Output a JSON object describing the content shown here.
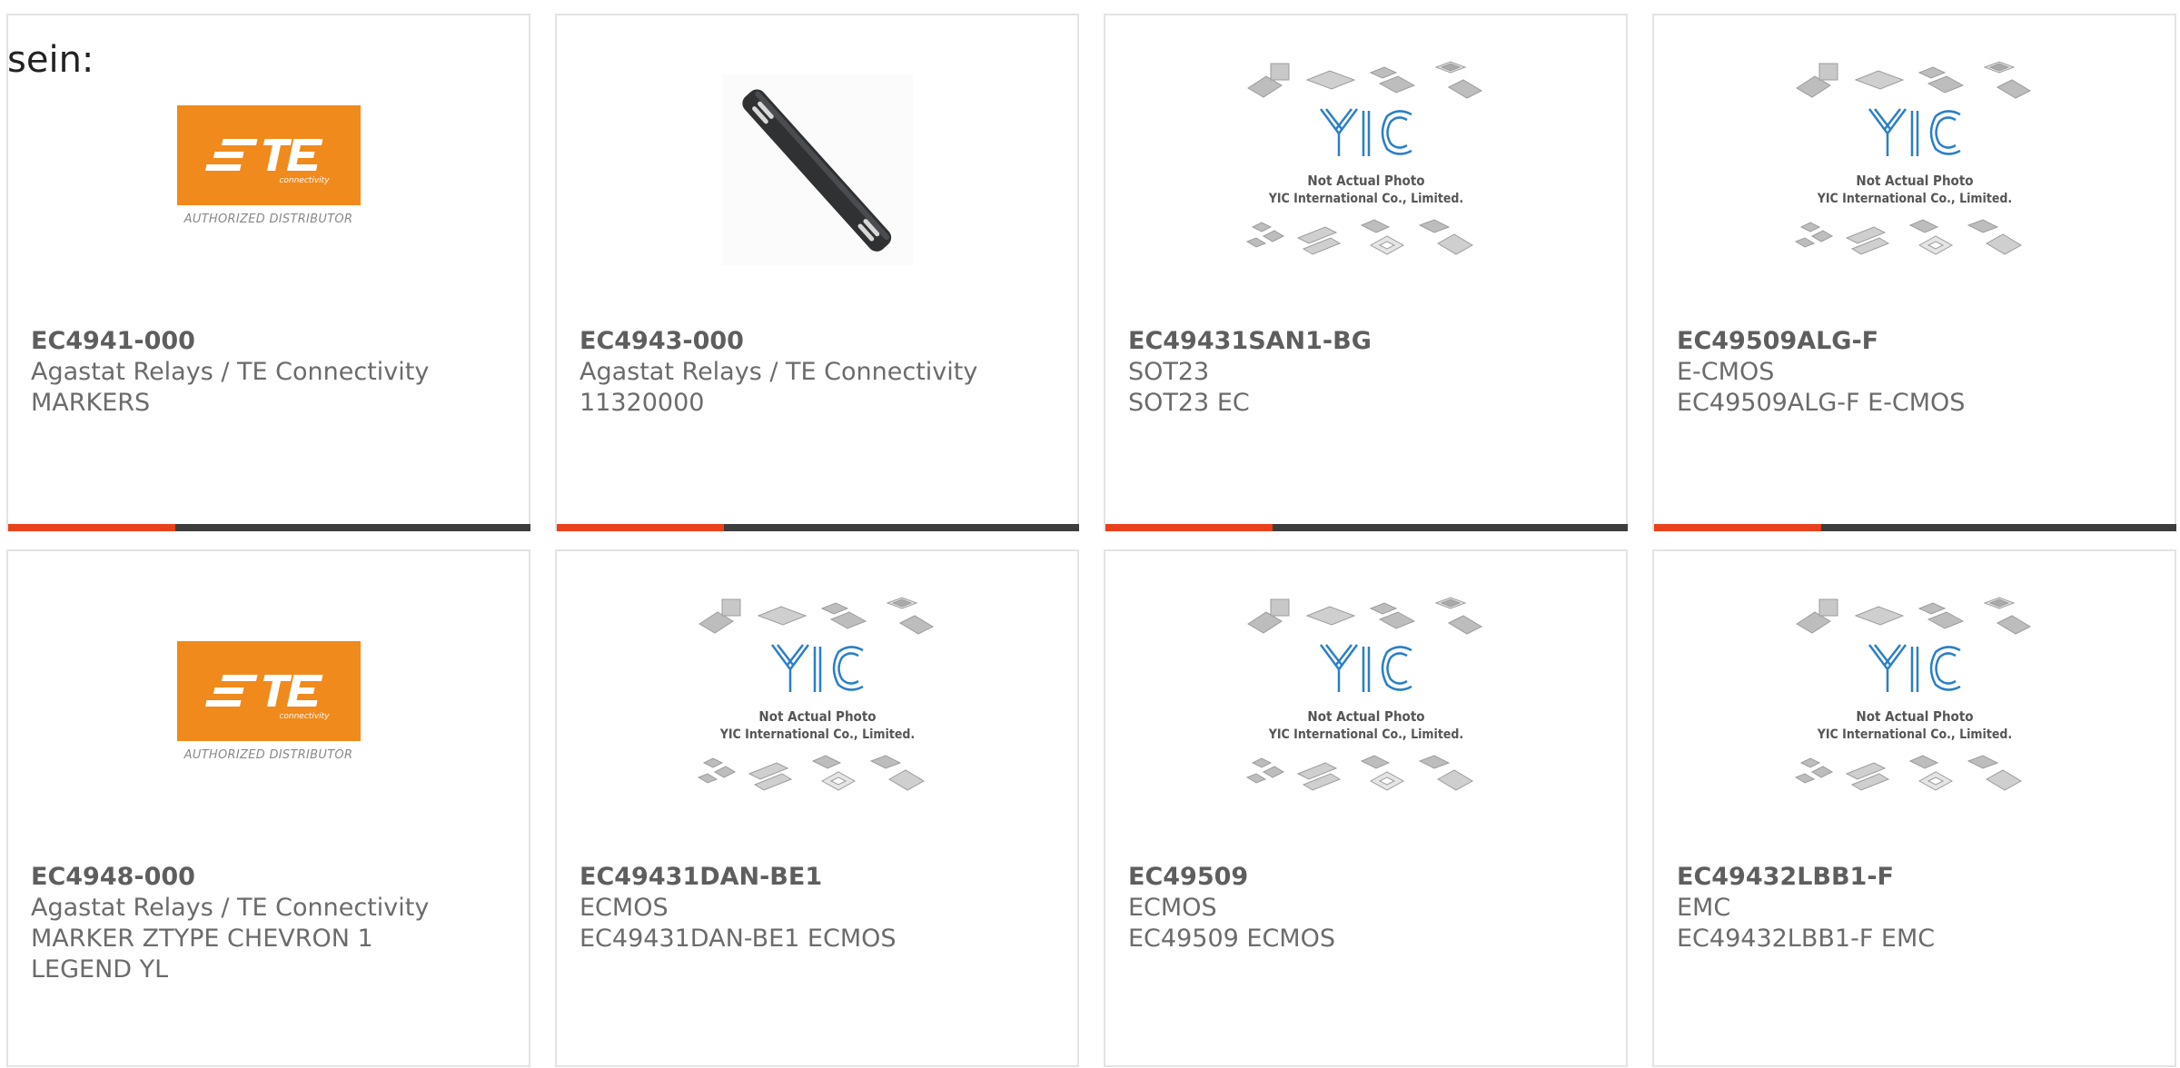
{
  "fragment_text": "sein:",
  "colors": {
    "accent": "#e8411b",
    "bar_dark": "#3d3d3d",
    "te_orange": "#f08a1c",
    "yic_blue": "#2a7fc6"
  },
  "te_logo": {
    "mark": "TE",
    "sub": "connectivity",
    "distributor": "AUTHORIZED DISTRIBUTOR"
  },
  "yic_placeholder": {
    "mark": "YIC",
    "line1": "Not Actual Photo",
    "line2": "YIC International Co., Limited."
  },
  "products": [
    {
      "part": "EC4941-000",
      "line2": "Agastat Relays / TE Connectivity",
      "line3": "MARKERS",
      "line4": "",
      "image": "te-logo",
      "accent_fraction": 0.32
    },
    {
      "part": "EC4943-000",
      "line2": "Agastat Relays / TE Connectivity",
      "line3": "11320000",
      "line4": "",
      "image": "marker-strip",
      "accent_fraction": 0.32
    },
    {
      "part": "EC49431SAN1-BG",
      "line2": "SOT23",
      "line3": "SOT23 EC",
      "line4": "",
      "image": "yic",
      "accent_fraction": 0.32
    },
    {
      "part": "EC49509ALG-F",
      "line2": "E-CMOS",
      "line3": "EC49509ALG-F E-CMOS",
      "line4": "",
      "image": "yic",
      "accent_fraction": 0.32
    },
    {
      "part": "EC4948-000",
      "line2": "Agastat Relays / TE Connectivity",
      "line3": "MARKER ZTYPE CHEVRON 1",
      "line4": "LEGEND YL",
      "image": "te-logo"
    },
    {
      "part": "EC49431DAN-BE1",
      "line2": "ECMOS",
      "line3": "EC49431DAN-BE1 ECMOS",
      "line4": "",
      "image": "yic"
    },
    {
      "part": "EC49509",
      "line2": "ECMOS",
      "line3": "EC49509 ECMOS",
      "line4": "",
      "image": "yic"
    },
    {
      "part": "EC49432LBB1-F",
      "line2": "EMC",
      "line3": "EC49432LBB1-F EMC",
      "line4": "",
      "image": "yic"
    }
  ]
}
